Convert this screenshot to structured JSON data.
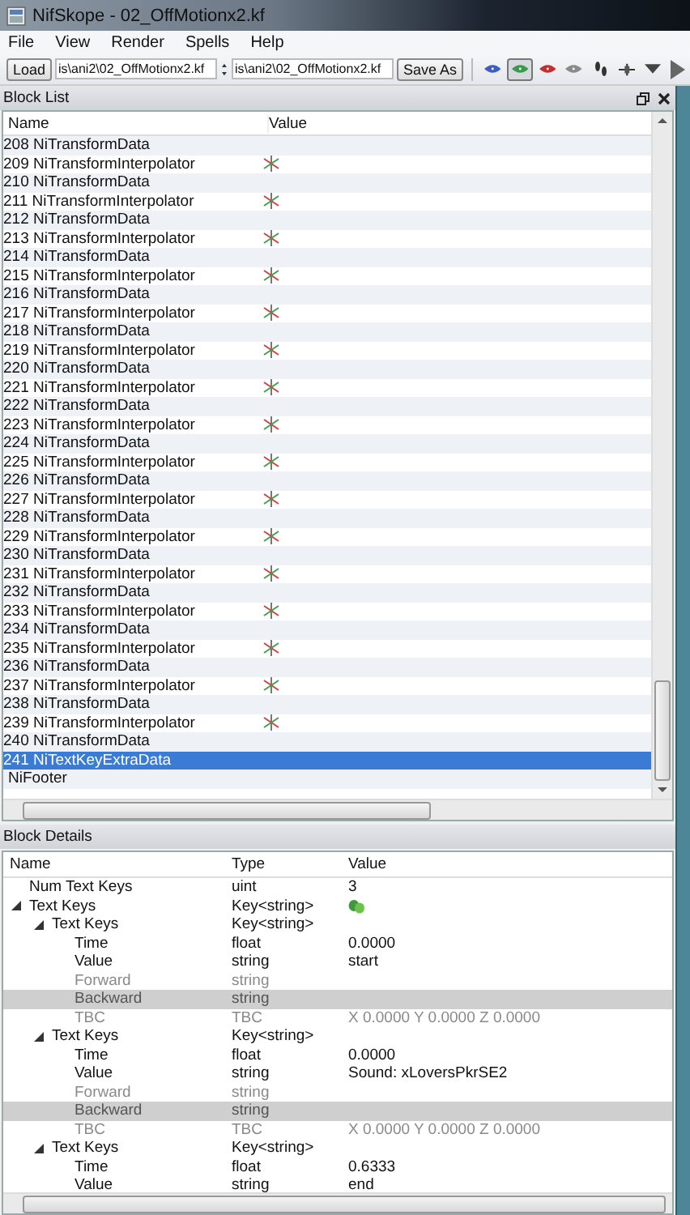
{
  "window": {
    "title": "NifSkope - 02_OffMotionx2.kf"
  },
  "menu": [
    "File",
    "View",
    "Render",
    "Spells",
    "Help"
  ],
  "toolbar": {
    "load": "Load",
    "file_in": "is\\ani2\\02_OffMotionx2.kf",
    "file_out": "is\\ani2\\02_OffMotionx2.kf",
    "save": "Save As",
    "tools": [
      {
        "kind": "eye",
        "color": "#3a5fc0",
        "selected": false
      },
      {
        "kind": "eye",
        "color": "#3a9a4a",
        "selected": true
      },
      {
        "kind": "eye",
        "color": "#c03030",
        "selected": false
      },
      {
        "kind": "eye",
        "color": "#8a8a8a",
        "selected": false
      },
      {
        "kind": "feet",
        "selected": false
      },
      {
        "kind": "move",
        "selected": false
      },
      {
        "kind": "dropdown",
        "selected": false
      },
      {
        "kind": "play",
        "selected": false
      }
    ]
  },
  "block_list": {
    "title": "Block List",
    "columns": [
      "Name",
      "Value"
    ],
    "rows": [
      {
        "name": "208 NiTransformData",
        "kind": "data",
        "selected": false
      },
      {
        "name": "209 NiTransformInterpolator",
        "kind": "interpolator",
        "selected": false
      },
      {
        "name": "210 NiTransformData",
        "kind": "data",
        "selected": false
      },
      {
        "name": "211 NiTransformInterpolator",
        "kind": "interpolator",
        "selected": false
      },
      {
        "name": "212 NiTransformData",
        "kind": "data",
        "selected": false
      },
      {
        "name": "213 NiTransformInterpolator",
        "kind": "interpolator",
        "selected": false
      },
      {
        "name": "214 NiTransformData",
        "kind": "data",
        "selected": false
      },
      {
        "name": "215 NiTransformInterpolator",
        "kind": "interpolator",
        "selected": false
      },
      {
        "name": "216 NiTransformData",
        "kind": "data",
        "selected": false
      },
      {
        "name": "217 NiTransformInterpolator",
        "kind": "interpolator",
        "selected": false
      },
      {
        "name": "218 NiTransformData",
        "kind": "data",
        "selected": false
      },
      {
        "name": "219 NiTransformInterpolator",
        "kind": "interpolator",
        "selected": false
      },
      {
        "name": "220 NiTransformData",
        "kind": "data",
        "selected": false
      },
      {
        "name": "221 NiTransformInterpolator",
        "kind": "interpolator",
        "selected": false
      },
      {
        "name": "222 NiTransformData",
        "kind": "data",
        "selected": false
      },
      {
        "name": "223 NiTransformInterpolator",
        "kind": "interpolator",
        "selected": false
      },
      {
        "name": "224 NiTransformData",
        "kind": "data",
        "selected": false
      },
      {
        "name": "225 NiTransformInterpolator",
        "kind": "interpolator",
        "selected": false
      },
      {
        "name": "226 NiTransformData",
        "kind": "data",
        "selected": false
      },
      {
        "name": "227 NiTransformInterpolator",
        "kind": "interpolator",
        "selected": false
      },
      {
        "name": "228 NiTransformData",
        "kind": "data",
        "selected": false
      },
      {
        "name": "229 NiTransformInterpolator",
        "kind": "interpolator",
        "selected": false
      },
      {
        "name": "230 NiTransformData",
        "kind": "data",
        "selected": false
      },
      {
        "name": "231 NiTransformInterpolator",
        "kind": "interpolator",
        "selected": false
      },
      {
        "name": "232 NiTransformData",
        "kind": "data",
        "selected": false
      },
      {
        "name": "233 NiTransformInterpolator",
        "kind": "interpolator",
        "selected": false
      },
      {
        "name": "234 NiTransformData",
        "kind": "data",
        "selected": false
      },
      {
        "name": "235 NiTransformInterpolator",
        "kind": "interpolator",
        "selected": false
      },
      {
        "name": "236 NiTransformData",
        "kind": "data",
        "selected": false
      },
      {
        "name": "237 NiTransformInterpolator",
        "kind": "interpolator",
        "selected": false
      },
      {
        "name": "238 NiTransformData",
        "kind": "data",
        "selected": false
      },
      {
        "name": "239 NiTransformInterpolator",
        "kind": "interpolator",
        "selected": false
      },
      {
        "name": "240 NiTransformData",
        "kind": "data",
        "selected": false
      },
      {
        "name": "241 NiTextKeyExtraData",
        "kind": "data",
        "selected": true
      },
      {
        "name": "NiFooter",
        "kind": "footer",
        "selected": false
      }
    ]
  },
  "block_details": {
    "title": "Block Details",
    "columns": [
      "Name",
      "Type",
      "Value"
    ],
    "rows": [
      {
        "name": "Num Text Keys",
        "type": "uint",
        "value": "3",
        "disabled": false,
        "shaded": false
      },
      {
        "name": "Text Keys",
        "type": "Key<string>",
        "value_icon": true,
        "disabled": false,
        "shaded": false,
        "expanded": true,
        "children": [
          {
            "name": "Text Keys",
            "type": "Key<string>",
            "disabled": false,
            "shaded": false,
            "expanded": true,
            "children": [
              {
                "name": "Time",
                "type": "float",
                "value": "0.0000",
                "disabled": false,
                "shaded": false
              },
              {
                "name": "Value",
                "type": "string",
                "value": "start",
                "disabled": false,
                "shaded": false
              },
              {
                "name": "Forward",
                "type": "string",
                "disabled": true,
                "shaded": false
              },
              {
                "name": "Backward",
                "type": "string",
                "disabled": true,
                "shaded": true
              },
              {
                "name": "TBC",
                "type": "TBC",
                "value": "X 0.0000 Y 0.0000 Z 0.0000",
                "disabled": true,
                "shaded": false
              }
            ]
          },
          {
            "name": "Text Keys",
            "type": "Key<string>",
            "disabled": false,
            "shaded": false,
            "expanded": true,
            "children": [
              {
                "name": "Time",
                "type": "float",
                "value": "0.0000",
                "disabled": false,
                "shaded": false
              },
              {
                "name": "Value",
                "type": "string",
                "value": "Sound: xLoversPkrSE2",
                "disabled": false,
                "shaded": false
              },
              {
                "name": "Forward",
                "type": "string",
                "disabled": true,
                "shaded": false
              },
              {
                "name": "Backward",
                "type": "string",
                "disabled": true,
                "shaded": true
              },
              {
                "name": "TBC",
                "type": "TBC",
                "value": "X 0.0000 Y 0.0000 Z 0.0000",
                "disabled": true,
                "shaded": false
              }
            ]
          },
          {
            "name": "Text Keys",
            "type": "Key<string>",
            "disabled": false,
            "shaded": false,
            "expanded": true,
            "children": [
              {
                "name": "Time",
                "type": "float",
                "value": "0.6333",
                "disabled": false,
                "shaded": false
              },
              {
                "name": "Value",
                "type": "string",
                "value": "end",
                "disabled": false,
                "shaded": false
              }
            ]
          }
        ]
      }
    ]
  }
}
